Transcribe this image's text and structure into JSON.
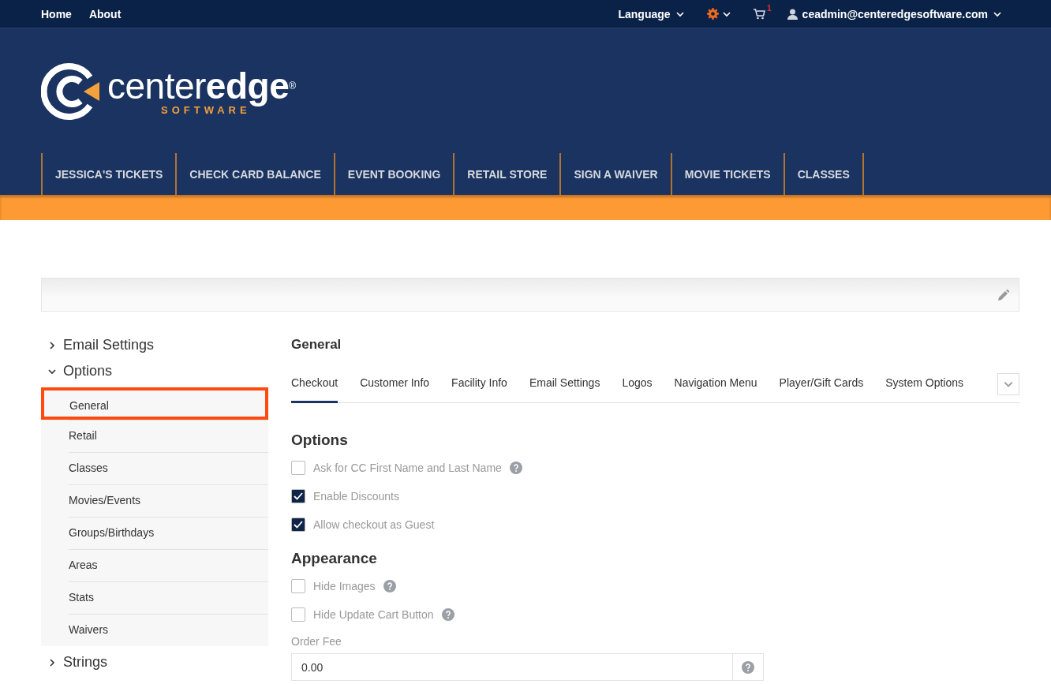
{
  "top_bar": {
    "links": [
      {
        "label": "Home"
      },
      {
        "label": "About"
      }
    ],
    "language": "Language",
    "cart_count": "1",
    "user": "ceadmin@centeredgesoftware.com"
  },
  "logo": {
    "name": "center**edge**$^{®}$",
    "tagline": "SOFTWARE"
  },
  "main_nav": [
    {
      "label": "JESSICA'S TICKETS"
    },
    {
      "label": "CHECK CARD BALANCE"
    },
    {
      "label": "EVENT BOOKING"
    },
    {
      "label": "RETAIL STORE"
    },
    {
      "label": "SIGN A WAIVER"
    },
    {
      "label": "MOVIE TICKETS"
    },
    {
      "label": "CLASSES"
    }
  ],
  "sidebar": {
    "groups": [
      {
        "label": "Email Settings",
        "expanded": false
      },
      {
        "label": "Options",
        "expanded": true,
        "children": [
          {
            "label": "General",
            "selected": true
          },
          {
            "label": "Retail",
            "selected": false
          },
          {
            "label": "Classes",
            "selected": false
          },
          {
            "label": "Movies/Events",
            "selected": false
          },
          {
            "label": "Groups/Birthdays",
            "selected": false
          },
          {
            "label": "Areas",
            "selected": false
          },
          {
            "label": "Stats",
            "selected": false
          },
          {
            "label": "Waivers",
            "selected": false
          }
        ]
      },
      {
        "label": "Strings",
        "expanded": false
      }
    ]
  },
  "content": {
    "title": "General",
    "tabs": [
      {
        "label": "Checkout",
        "selected": true
      },
      {
        "label": "Customer Info",
        "selected": false
      },
      {
        "label": "Facility Info",
        "selected": false
      },
      {
        "label": "Email Settings",
        "selected": false
      },
      {
        "label": "Logos",
        "selected": false
      },
      {
        "label": "Navigation Menu",
        "selected": false
      },
      {
        "label": "Player/Gift Cards",
        "selected": false
      },
      {
        "label": "System Options",
        "selected": false
      }
    ],
    "sections": [
      {
        "heading": "Options",
        "items": [
          {
            "kind": "checkbox",
            "label": "Ask for CC First Name and Last Name",
            "checked": false,
            "help": true
          },
          {
            "kind": "checkbox",
            "label": "Enable Discounts",
            "checked": true,
            "help": false
          },
          {
            "kind": "checkbox",
            "label": "Allow checkout as Guest",
            "checked": true,
            "help": false
          }
        ]
      },
      {
        "heading": "Appearance",
        "items": [
          {
            "kind": "checkbox",
            "label": "Hide Images",
            "checked": false,
            "help": true
          },
          {
            "kind": "checkbox",
            "label": "Hide Update Cart Button",
            "checked": false,
            "help": true
          },
          {
            "kind": "field",
            "label": "Order Fee",
            "value": "0.00",
            "help": true
          }
        ]
      }
    ]
  }
}
